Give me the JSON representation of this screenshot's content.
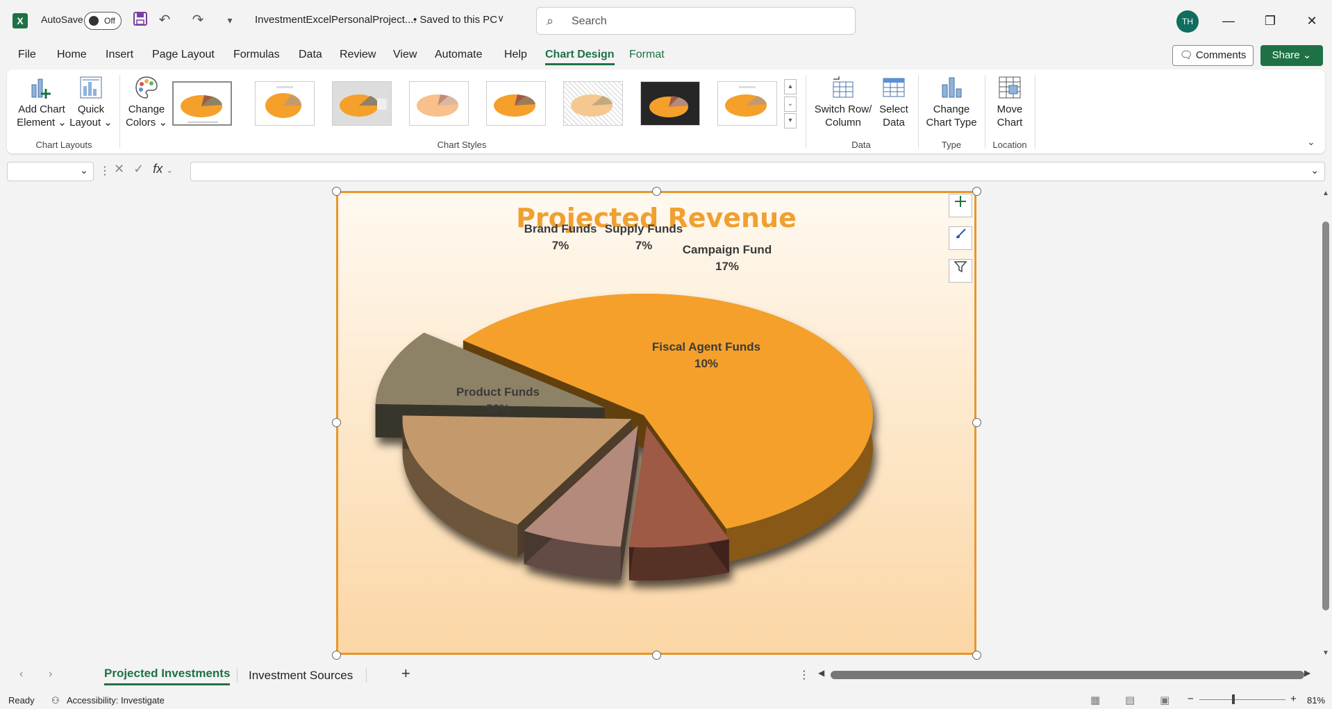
{
  "app": {
    "logo_letter": "X",
    "autosave_label": "AutoSave",
    "autosave_state": "Off",
    "doc_title": "InvestmentExcelPersonalProject....",
    "doc_saved": "• Saved to this PC",
    "search_placeholder": "Search",
    "avatar_initials": "TH"
  },
  "menu": {
    "tabs": [
      "File",
      "Home",
      "Insert",
      "Page Layout",
      "Formulas",
      "Data",
      "Review",
      "View",
      "Automate",
      "Help",
      "Chart Design",
      "Format"
    ],
    "active": "Chart Design",
    "comments": "Comments",
    "share": "Share"
  },
  "ribbon": {
    "add_chart_element": [
      "Add Chart",
      "Element"
    ],
    "quick_layout": [
      "Quick",
      "Layout"
    ],
    "chart_layouts_label": "Chart Layouts",
    "change_colors": [
      "Change",
      "Colors"
    ],
    "chart_styles_label": "Chart Styles",
    "switch_row_column": [
      "Switch Row/",
      "Column"
    ],
    "select_data": [
      "Select",
      "Data"
    ],
    "data_label": "Data",
    "change_chart_type": [
      "Change",
      "Chart Type"
    ],
    "type_label": "Type",
    "move_chart": [
      "Move",
      "Chart"
    ],
    "location_label": "Location"
  },
  "formula_bar": {
    "fx": "fx",
    "name_box": "",
    "formula": ""
  },
  "chart_data": {
    "type": "pie",
    "title": "Projected Revenue",
    "categories": [
      "Product Funds",
      "Brand Funds",
      "Supply Funds",
      "Campaign Fund",
      "Fiscal Agent Funds"
    ],
    "values": [
      58,
      7,
      7,
      17,
      10
    ],
    "labels": [
      "58%",
      "7%",
      "7%",
      "17%",
      "10%"
    ],
    "colors": [
      "#f5a02a",
      "#9e5a44",
      "#b48a7c",
      "#c49a6c",
      "#8d8266"
    ],
    "legend": "none",
    "exploded": true,
    "three_d": true
  },
  "sheets": {
    "tabs": [
      "Projected Investments",
      "Investment Sources"
    ],
    "active": "Projected Investments"
  },
  "status": {
    "ready": "Ready",
    "accessibility": "Accessibility: Investigate",
    "zoom": "81%"
  }
}
